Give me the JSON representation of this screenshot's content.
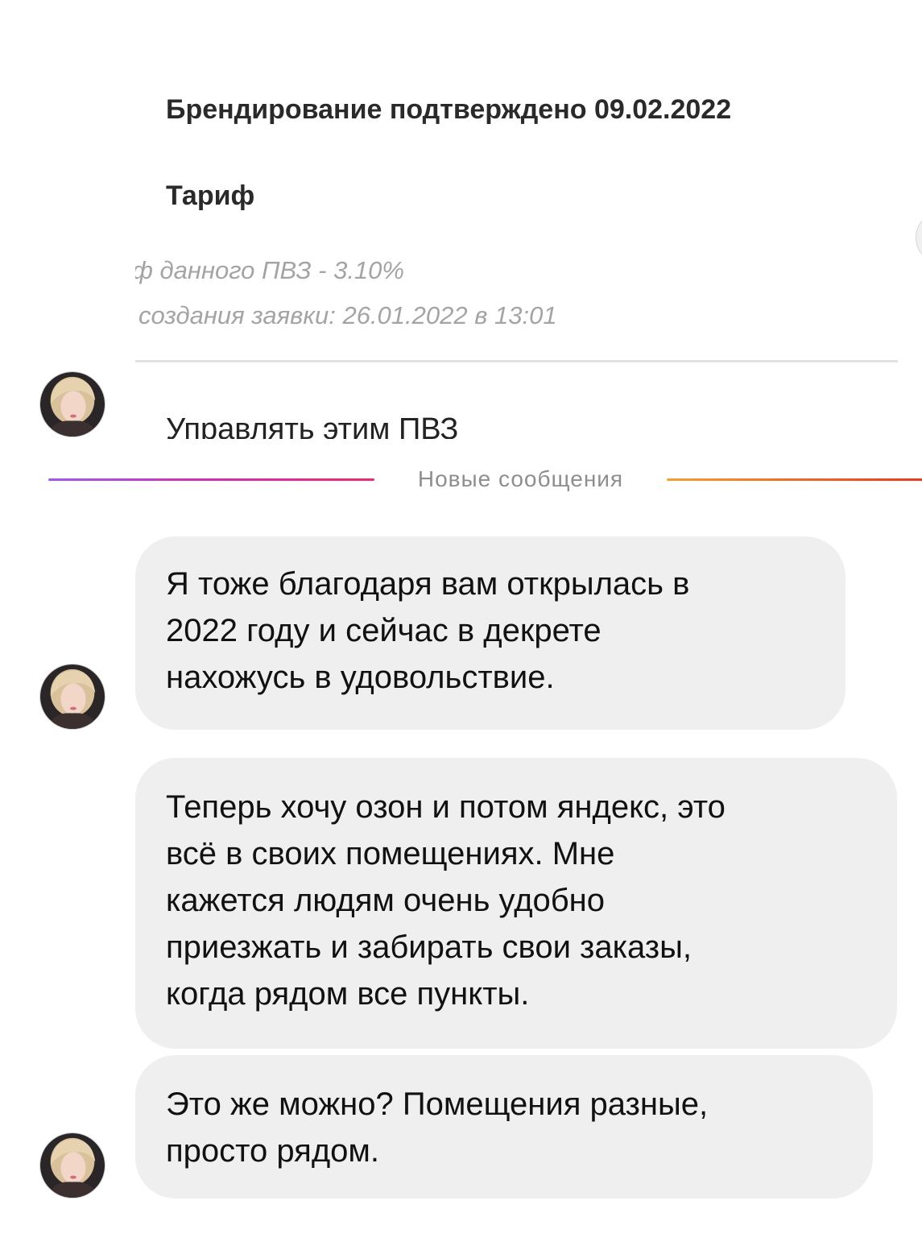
{
  "screenshot": {
    "branding_confirmed": "Брендирование подтверждено 09.02.2022",
    "tariff_heading": "Тариф",
    "tariff_line": "ф данного ПВЗ - 3.10%",
    "application_line": "создания заявки: 26.01.2022 в 13:01",
    "manage_link": "Управлять этим ПВЗ"
  },
  "divider": {
    "label": "Новые сообщения"
  },
  "messages": [
    {
      "lines": [
        "Я тоже благодаря вам открылась в",
        "2022 году и сейчас в декрете",
        "нахожусь в удовольствие."
      ]
    },
    {
      "lines": [
        "Теперь хочу озон и потом яндекс, это",
        "всё в своих помещениях. Мне",
        "кажется людям очень удобно",
        "приезжать и забирать свои заказы,",
        "когда рядом все пункты."
      ]
    },
    {
      "lines": [
        "Это же можно? Помещения разные,",
        "просто рядом."
      ]
    }
  ]
}
